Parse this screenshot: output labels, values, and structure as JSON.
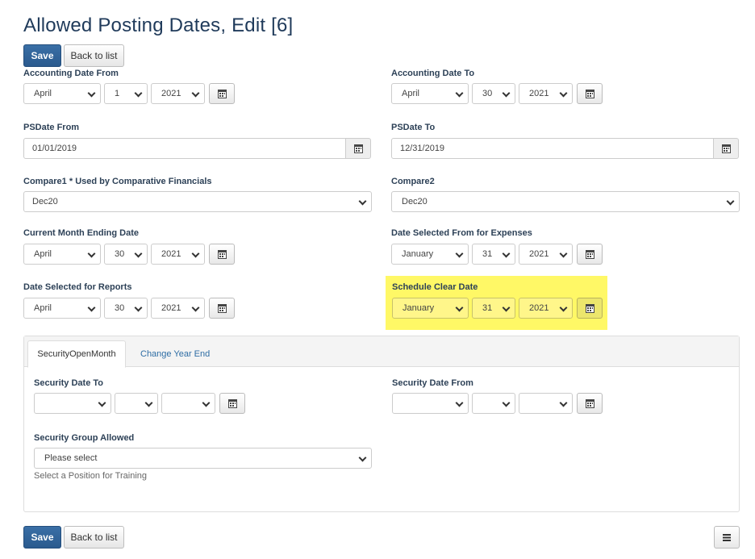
{
  "page": {
    "title": "Allowed Posting Dates, Edit [6]"
  },
  "actions": {
    "save": "Save",
    "back": "Back to list"
  },
  "fields": {
    "accounting_from": {
      "label": "Accounting Date From",
      "month": "April",
      "day": "1",
      "year": "2021"
    },
    "accounting_to": {
      "label": "Accounting Date To",
      "month": "April",
      "day": "30",
      "year": "2021"
    },
    "psdate_from": {
      "label": "PSDate From",
      "value": "01/01/2019"
    },
    "psdate_to": {
      "label": "PSDate To",
      "value": "12/31/2019"
    },
    "compare1": {
      "label": "Compare1 * Used by Comparative Financials",
      "value": "Dec20"
    },
    "compare2": {
      "label": "Compare2",
      "value": "Dec20"
    },
    "current_month_end": {
      "label": "Current Month Ending Date",
      "month": "April",
      "day": "30",
      "year": "2021"
    },
    "expenses_from": {
      "label": "Date Selected From for Expenses",
      "month": "January",
      "day": "31",
      "year": "2021"
    },
    "reports": {
      "label": "Date Selected for Reports",
      "month": "April",
      "day": "30",
      "year": "2021"
    },
    "schedule_clear": {
      "label": "Schedule Clear Date",
      "month": "January",
      "day": "31",
      "year": "2021",
      "highlight_color": "#fff866"
    }
  },
  "tabs": {
    "active": "SecurityOpenMonth",
    "other": "Change Year End"
  },
  "security": {
    "date_to_label": "Security Date To",
    "date_from_label": "Security Date From",
    "group_label": "Security Group Allowed",
    "group_value": "Please select",
    "help": "Select a Position for Training"
  },
  "colors": {
    "primary": "#2a5a8e",
    "title": "#1f3a5a",
    "link": "#2e6da4"
  }
}
